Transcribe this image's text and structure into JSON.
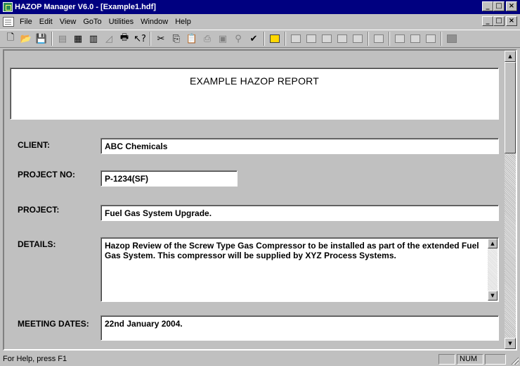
{
  "window": {
    "title": "HAZOP Manager V6.0 - [Example1.hdf]",
    "min": "_",
    "max": "□",
    "close": "×"
  },
  "menu": [
    "File",
    "Edit",
    "View",
    "GoTo",
    "Utilities",
    "Window",
    "Help"
  ],
  "toolbar_icons": [
    "new-icon",
    "open-icon",
    "save-icon",
    "worksheet-icon",
    "tree-icon",
    "table-icon",
    "chart-icon",
    "print-icon",
    "context-help-icon",
    "cut-icon",
    "copy-icon",
    "paste-icon",
    "insert-icon",
    "insert-rows-icon",
    "find-icon",
    "spellcheck-icon",
    "report-icon"
  ],
  "report": {
    "title": "EXAMPLE HAZOP REPORT"
  },
  "form": {
    "client_label": "CLIENT:",
    "client_value": "ABC Chemicals",
    "project_no_label": "PROJECT NO:",
    "project_no_value": "P-1234(SF)",
    "project_label": "PROJECT:",
    "project_value": "Fuel Gas System Upgrade.",
    "details_label": "DETAILS:",
    "details_value": "Hazop Review of the Screw Type Gas Compressor to be installed as part of the extended Fuel Gas System.  This compressor will be supplied by XYZ Process Systems.",
    "meeting_dates_label": "MEETING DATES:",
    "meeting_dates_value": "22nd January 2004."
  },
  "status": {
    "help": "For Help, press F1",
    "num": "NUM"
  }
}
